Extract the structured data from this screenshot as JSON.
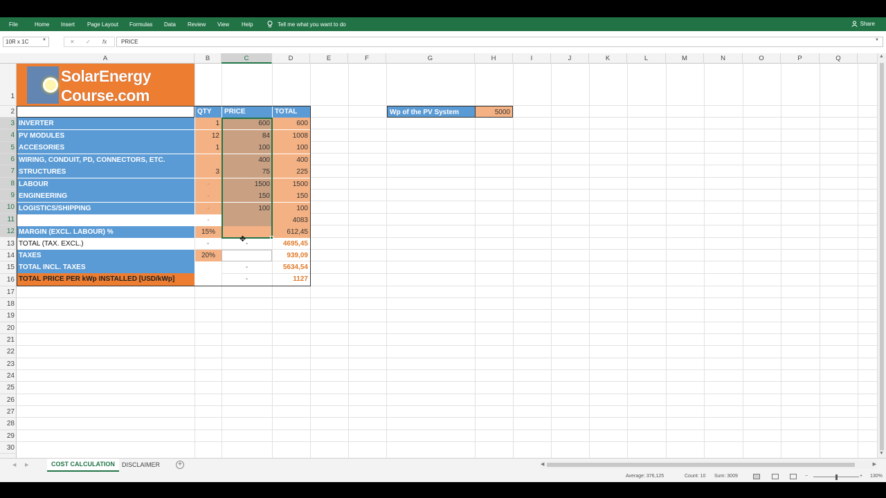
{
  "ribbon": {
    "tabs": [
      "File",
      "Home",
      "Insert",
      "Page Layout",
      "Formulas",
      "Data",
      "Review",
      "View",
      "Help"
    ],
    "tell_me": "Tell me what you want to do",
    "share": "Share",
    "bg_color": "#217346"
  },
  "formula_bar": {
    "name_box": "10R x 1C",
    "formula": "PRICE",
    "fx": "fx"
  },
  "columns": [
    "A",
    "B",
    "C",
    "D",
    "E",
    "F",
    "G",
    "H",
    "I",
    "J",
    "K",
    "L",
    "M",
    "N",
    "O",
    "P",
    "Q"
  ],
  "rows": [
    "1",
    "2",
    "3",
    "4",
    "5",
    "6",
    "7",
    "8",
    "9",
    "10",
    "11",
    "12",
    "13",
    "14",
    "15",
    "16",
    "17",
    "18",
    "19",
    "20",
    "21",
    "22",
    "23",
    "24",
    "25",
    "26",
    "27",
    "28",
    "29",
    "30"
  ],
  "logo": {
    "line1": "SolarEnergy",
    "line2": "Course.com"
  },
  "table": {
    "headers": {
      "qty": "QTY",
      "price": "PRICE",
      "total": "TOTAL"
    },
    "items": [
      {
        "label": "INVERTER",
        "qty": "1",
        "price": "600",
        "total": "600"
      },
      {
        "label": "PV MODULES",
        "qty": "12",
        "price": "84",
        "total": "1008"
      },
      {
        "label": "ACCESORIES",
        "qty": "1",
        "price": "100",
        "total": "100"
      },
      {
        "label": "WIRING, CONDUIT, PD, CONNECTORS,  ETC.",
        "qty": "",
        "price": "400",
        "total": "400"
      },
      {
        "label": "STRUCTURES",
        "qty": "3",
        "price": "75",
        "total": "225"
      },
      {
        "label": "LABOUR",
        "qty": "-",
        "price": "1500",
        "total": "1500"
      },
      {
        "label": "ENGINEERING",
        "qty": "-",
        "price": "150",
        "total": "150"
      },
      {
        "label": "LOGISTICS/SHIPPING",
        "qty": "-",
        "price": "100",
        "total": "100"
      }
    ],
    "subtotal": {
      "label": "",
      "qty": "-",
      "price": "",
      "total": "4083"
    },
    "margin": {
      "label": "MARGIN (EXCL. LABOUR) %",
      "qty": "15%",
      "price": "",
      "total": "612,45"
    },
    "total_excl": {
      "label": "TOTAL (TAX. EXCL.)",
      "qty": "-",
      "price": "-",
      "total": "4695,45"
    },
    "taxes": {
      "label": "TAXES",
      "qty": "20%",
      "price": "",
      "total": "939,09"
    },
    "total_incl": {
      "label": "TOTAL INCL. TAXES",
      "qty": "",
      "price": "-",
      "total": "5634,54"
    },
    "per_kwp": {
      "label": "TOTAL PRICE PER kWp INSTALLED  [USD/kWp]",
      "qty": "",
      "price": "-",
      "total": "1127"
    }
  },
  "wp": {
    "label": "Wp of the PV System",
    "value": "5000"
  },
  "sheets": [
    {
      "name": "COST CALCULATION",
      "active": true
    },
    {
      "name": "DISCLAIMER",
      "active": false
    }
  ],
  "status": {
    "average": "Average: 376,125",
    "count": "Count: 10",
    "sum": "Sum: 3009",
    "zoom": "130%"
  },
  "colors": {
    "blue": "#5b9bd5",
    "peach": "#f4b183",
    "tan": "#c9a082",
    "orange": "#ed7d31",
    "green": "#217346"
  }
}
